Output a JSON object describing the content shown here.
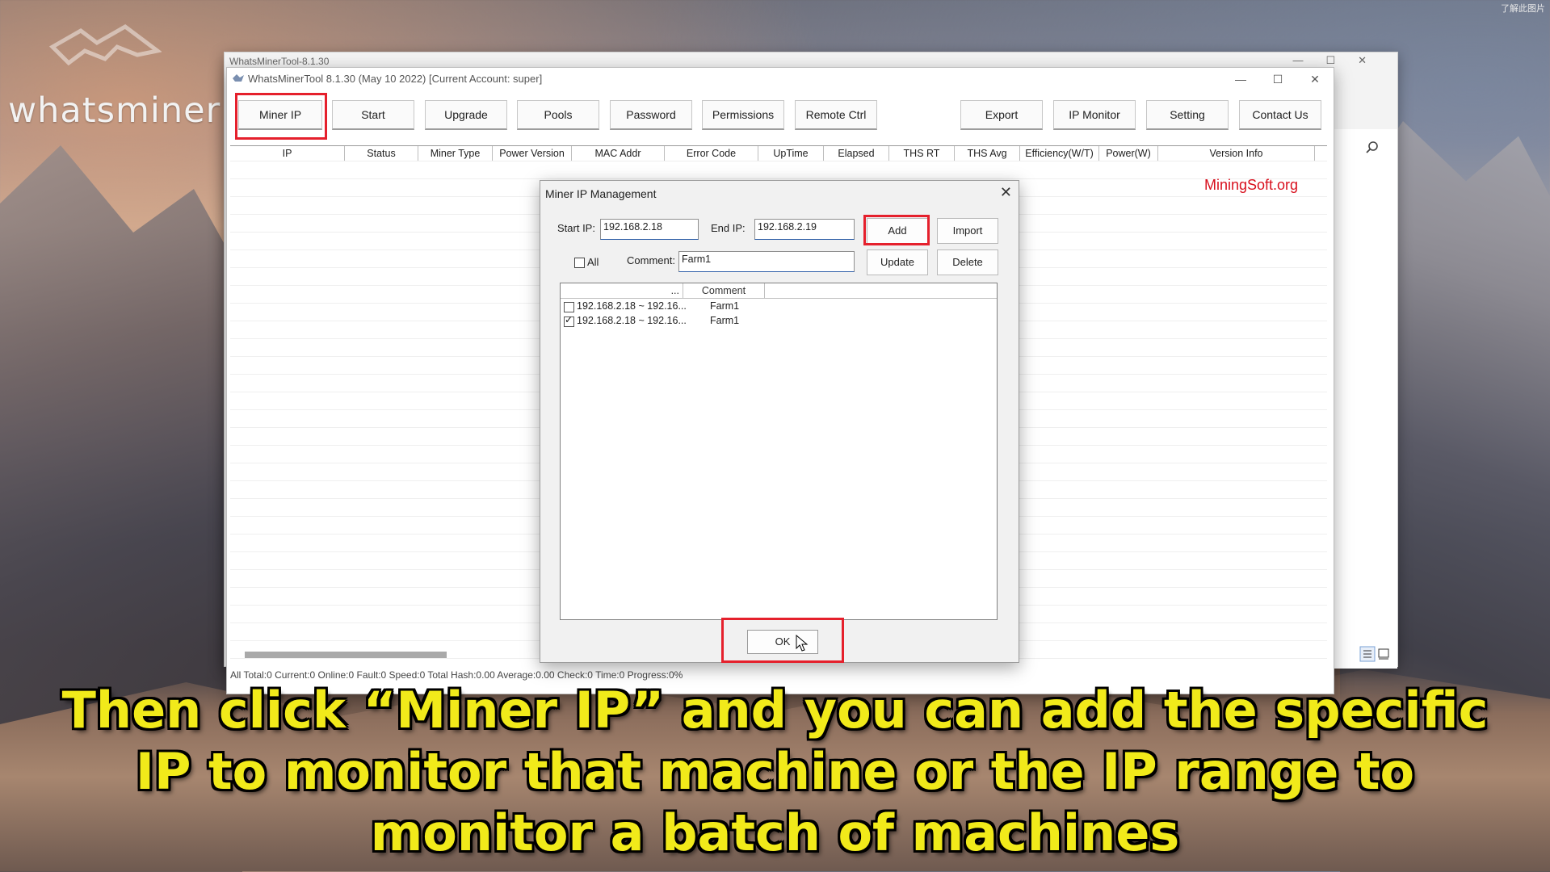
{
  "brand": {
    "logo_text": "whatsminer"
  },
  "corner_text": "了解此图片",
  "back_window": {
    "title": "WhatsMinerTool-8.1.30"
  },
  "main_window": {
    "title": "WhatsMinerTool 8.1.30 (May 10 2022) [Current Account: super]",
    "toolbar": {
      "buttons": [
        {
          "label": "Miner IP"
        },
        {
          "label": "Start"
        },
        {
          "label": "Upgrade"
        },
        {
          "label": "Pools"
        },
        {
          "label": "Password"
        },
        {
          "label": "Permissions"
        },
        {
          "label": "Remote Ctrl"
        },
        {
          "label": "Export"
        },
        {
          "label": "IP Monitor"
        },
        {
          "label": "Setting"
        },
        {
          "label": "Contact Us"
        }
      ]
    },
    "grid": {
      "columns": [
        "IP",
        "Status",
        "Miner Type",
        "Power Version",
        "MAC Addr",
        "Error Code",
        "UpTime",
        "Elapsed",
        "THS RT",
        "THS Avg",
        "Efficiency(W/T)",
        "Power(W)",
        "Version Info"
      ]
    },
    "watermark": "MiningSoft.org",
    "status_bar": "All  Total:0  Current:0  Online:0  Fault:0  Speed:0  Total Hash:0.00  Average:0.00  Check:0  Time:0  Progress:0%"
  },
  "dialog": {
    "title": "Miner IP Management",
    "start_ip_label": "Start IP:",
    "start_ip_value": "192.168.2.18",
    "end_ip_label": "End IP:",
    "end_ip_value": "192.168.2.19",
    "add_label": "Add",
    "import_label": "Import",
    "all_label": "All",
    "comment_label": "Comment:",
    "comment_value": "Farm1",
    "update_label": "Update",
    "delete_label": "Delete",
    "list": {
      "columns": [
        "...",
        "Comment"
      ],
      "rows": [
        {
          "range": "192.168.2.18 ~ 192.16...",
          "comment": "Farm1",
          "checked": false
        },
        {
          "range": "192.168.2.18 ~ 192.16...",
          "comment": "Farm1",
          "checked": true
        }
      ]
    },
    "ok_label": "OK"
  },
  "subtitle": {
    "line1": "Then click “Miner IP” and you can add the specific",
    "line2": "IP to monitor that machine or the IP range to",
    "line3": "monitor a batch of machines"
  },
  "colors": {
    "highlight": "#e5202c",
    "subtitle": "#f1ea1a",
    "watermark": "#d8101e"
  }
}
